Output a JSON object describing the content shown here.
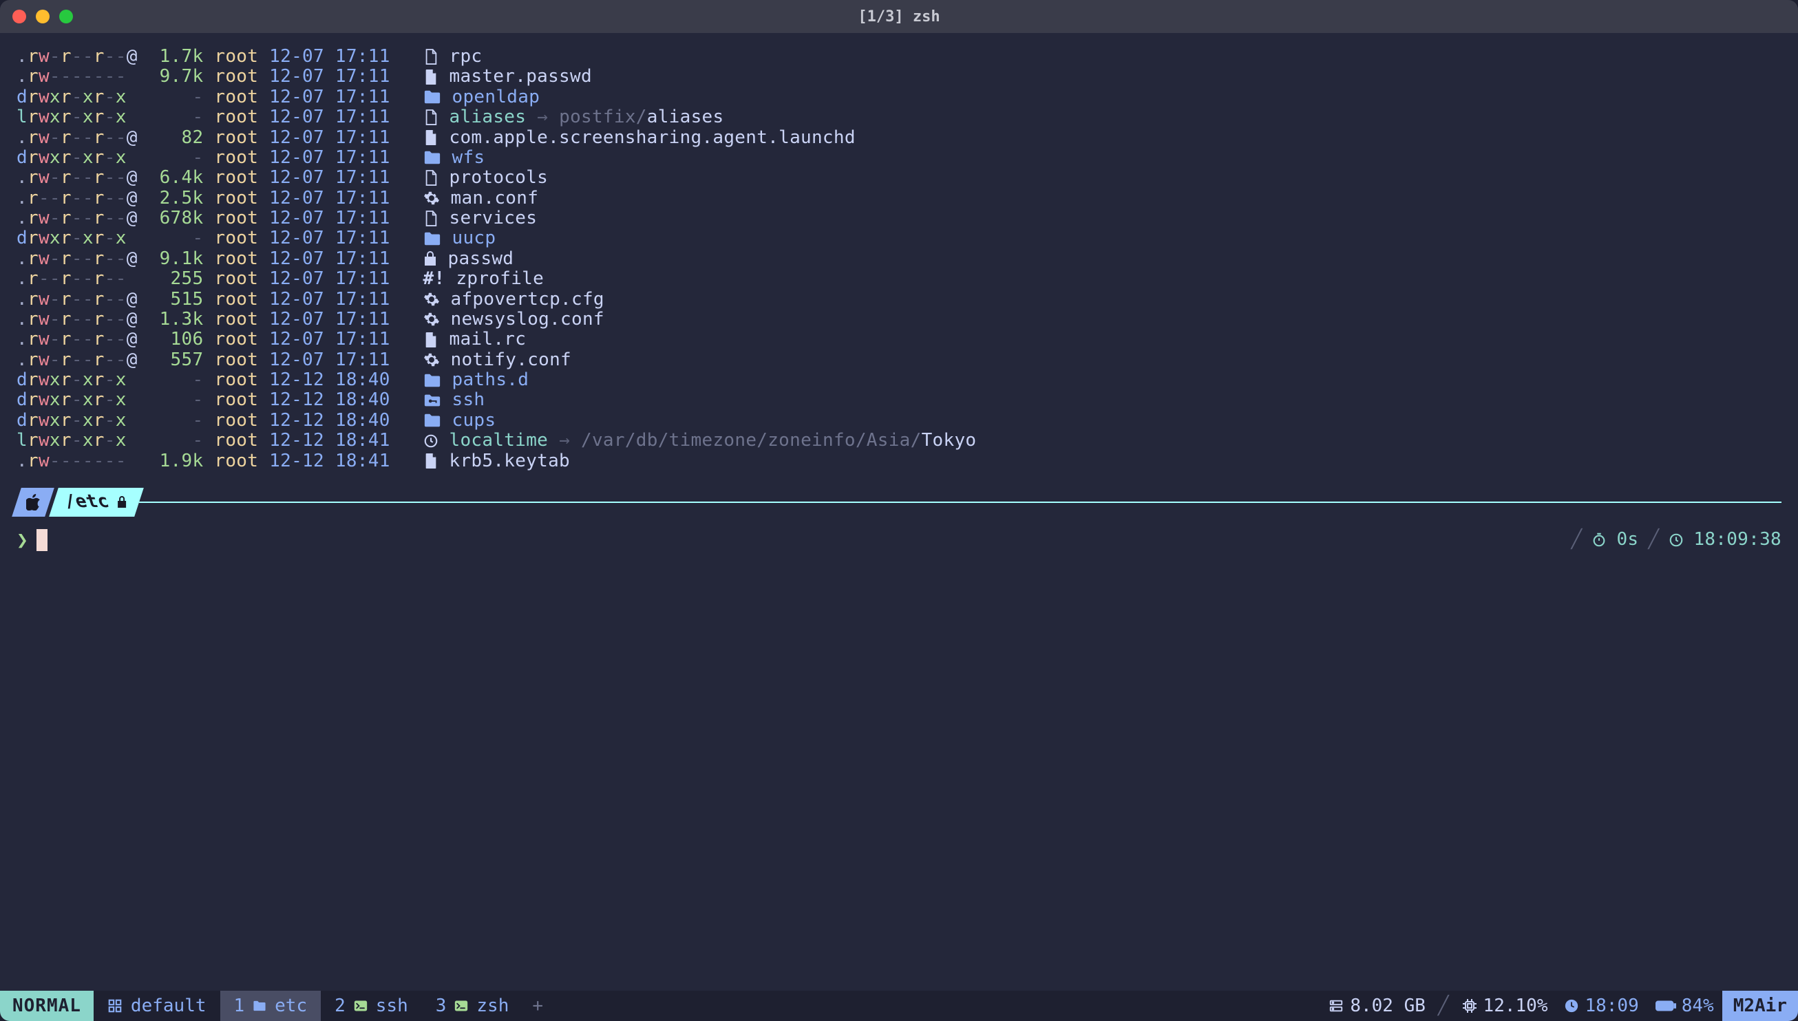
{
  "title": "[1/3] zsh",
  "files": [
    {
      "t": ".",
      "p": "rw-r--r--",
      "x": "@",
      "size": "1.7k",
      "owner": "root",
      "date": "12-07 17:11",
      "icon": "file",
      "name": "rpc"
    },
    {
      "t": ".",
      "p": "rw-------",
      "x": " ",
      "size": "9.7k",
      "owner": "root",
      "date": "12-07 17:11",
      "icon": "doc",
      "name": "master.passwd"
    },
    {
      "t": "d",
      "p": "rwxr-xr-x",
      "x": " ",
      "size": "-",
      "owner": "root",
      "date": "12-07 17:11",
      "icon": "folder",
      "name": "openldap"
    },
    {
      "t": "l",
      "p": "rwxr-xr-x",
      "x": " ",
      "size": "-",
      "owner": "root",
      "date": "12-07 17:11",
      "icon": "file",
      "name": "aliases",
      "sym": true,
      "target": "postfix/aliases",
      "targetBright": "aliases"
    },
    {
      "t": ".",
      "p": "rw-r--r--",
      "x": "@",
      "size": "82",
      "owner": "root",
      "date": "12-07 17:11",
      "icon": "doc",
      "name": "com.apple.screensharing.agent.launchd"
    },
    {
      "t": "d",
      "p": "rwxr-xr-x",
      "x": " ",
      "size": "-",
      "owner": "root",
      "date": "12-07 17:11",
      "icon": "folder",
      "name": "wfs"
    },
    {
      "t": ".",
      "p": "rw-r--r--",
      "x": "@",
      "size": "6.4k",
      "owner": "root",
      "date": "12-07 17:11",
      "icon": "file",
      "name": "protocols"
    },
    {
      "t": ".",
      "p": "r--r--r--",
      "x": "@",
      "size": "2.5k",
      "owner": "root",
      "date": "12-07 17:11",
      "icon": "gear",
      "name": "man.conf"
    },
    {
      "t": ".",
      "p": "rw-r--r--",
      "x": "@",
      "size": "678k",
      "owner": "root",
      "date": "12-07 17:11",
      "icon": "file",
      "name": "services"
    },
    {
      "t": "d",
      "p": "rwxr-xr-x",
      "x": " ",
      "size": "-",
      "owner": "root",
      "date": "12-07 17:11",
      "icon": "folder",
      "name": "uucp"
    },
    {
      "t": ".",
      "p": "rw-r--r--",
      "x": "@",
      "size": "9.1k",
      "owner": "root",
      "date": "12-07 17:11",
      "icon": "lock",
      "name": "passwd"
    },
    {
      "t": ".",
      "p": "r--r--r--",
      "x": " ",
      "size": "255",
      "owner": "root",
      "date": "12-07 17:11",
      "icon": "hash",
      "name": "zprofile"
    },
    {
      "t": ".",
      "p": "rw-r--r--",
      "x": "@",
      "size": "515",
      "owner": "root",
      "date": "12-07 17:11",
      "icon": "gear",
      "name": "afpovertcp.cfg"
    },
    {
      "t": ".",
      "p": "rw-r--r--",
      "x": "@",
      "size": "1.3k",
      "owner": "root",
      "date": "12-07 17:11",
      "icon": "gear",
      "name": "newsyslog.conf"
    },
    {
      "t": ".",
      "p": "rw-r--r--",
      "x": "@",
      "size": "106",
      "owner": "root",
      "date": "12-07 17:11",
      "icon": "doc",
      "name": "mail.rc"
    },
    {
      "t": ".",
      "p": "rw-r--r--",
      "x": "@",
      "size": "557",
      "owner": "root",
      "date": "12-07 17:11",
      "icon": "gear",
      "name": "notify.conf"
    },
    {
      "t": "d",
      "p": "rwxr-xr-x",
      "x": " ",
      "size": "-",
      "owner": "root",
      "date": "12-12 18:40",
      "icon": "folder",
      "name": "paths.d"
    },
    {
      "t": "d",
      "p": "rwxr-xr-x",
      "x": " ",
      "size": "-",
      "owner": "root",
      "date": "12-12 18:40",
      "icon": "key",
      "name": "ssh"
    },
    {
      "t": "d",
      "p": "rwxr-xr-x",
      "x": " ",
      "size": "-",
      "owner": "root",
      "date": "12-12 18:40",
      "icon": "folder",
      "name": "cups"
    },
    {
      "t": "l",
      "p": "rwxr-xr-x",
      "x": " ",
      "size": "-",
      "owner": "root",
      "date": "12-12 18:41",
      "icon": "clock",
      "name": "localtime",
      "sym": true,
      "target": "/var/db/timezone/zoneinfo/Asia/Tokyo",
      "targetBright": "Tokyo"
    },
    {
      "t": ".",
      "p": "rw-------",
      "x": " ",
      "size": "1.9k",
      "owner": "root",
      "date": "12-12 18:41",
      "icon": "doc",
      "name": "krb5.keytab"
    }
  ],
  "prompt": {
    "segment1": "",
    "segment2": "/etc",
    "char": "❯"
  },
  "rightinfo": {
    "duration": "0s",
    "clock": "18:09:38"
  },
  "status": {
    "mode": "NORMAL",
    "session": "default",
    "tabs": [
      {
        "num": "1",
        "label": "etc",
        "icon": "folder",
        "active": true
      },
      {
        "num": "2",
        "label": "ssh",
        "icon": "term"
      },
      {
        "num": "3",
        "label": "zsh",
        "icon": "term"
      }
    ],
    "disk": "8.02 GB",
    "cpu": "12.10%",
    "time": "18:09",
    "battery": "84%",
    "host": "M2Air"
  }
}
